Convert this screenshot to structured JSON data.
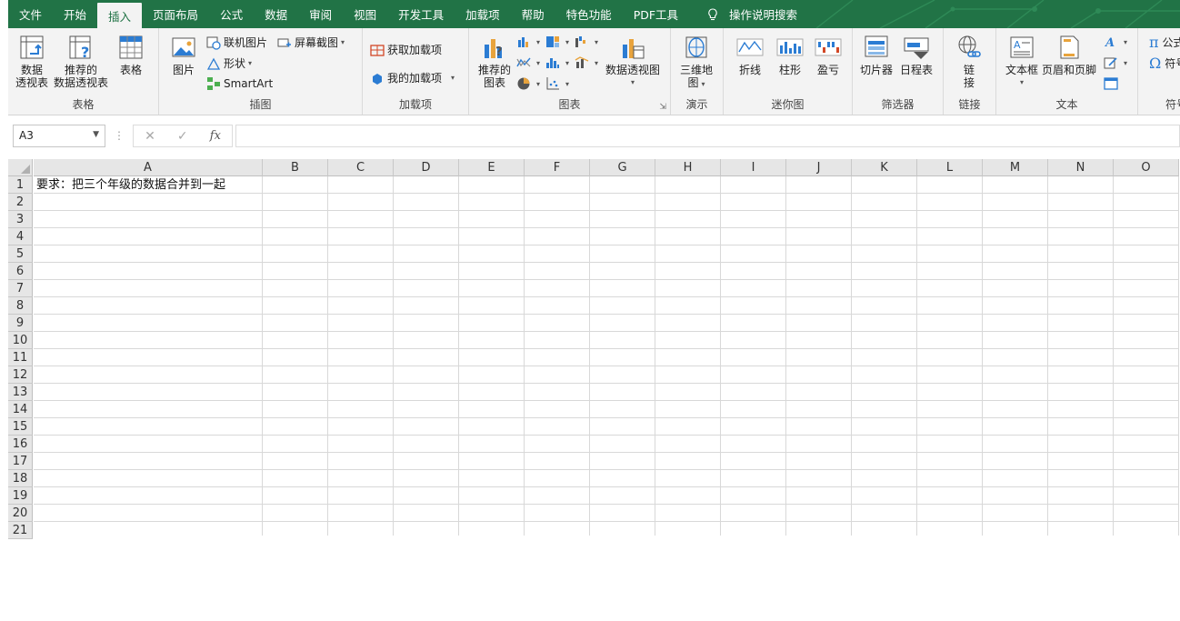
{
  "tabs": [
    {
      "label": "文件",
      "active": false
    },
    {
      "label": "开始",
      "active": false
    },
    {
      "label": "插入",
      "active": true
    },
    {
      "label": "页面布局",
      "active": false
    },
    {
      "label": "公式",
      "active": false
    },
    {
      "label": "数据",
      "active": false
    },
    {
      "label": "审阅",
      "active": false
    },
    {
      "label": "视图",
      "active": false
    },
    {
      "label": "开发工具",
      "active": false
    },
    {
      "label": "加载项",
      "active": false
    },
    {
      "label": "帮助",
      "active": false
    },
    {
      "label": "特色功能",
      "active": false
    },
    {
      "label": "PDF工具",
      "active": false
    }
  ],
  "tell_me": "操作说明搜索",
  "ribbon": {
    "tables": {
      "label": "表格",
      "pivot_line1": "数据",
      "pivot_line2": "透视表",
      "recpivot_line1": "推荐的",
      "recpivot_line2": "数据透视表",
      "table": "表格"
    },
    "illustrations": {
      "label": "插图",
      "picture": "图片",
      "online_picture": "联机图片",
      "shapes": "形状",
      "smartart": "SmartArt",
      "screenshot": "屏幕截图"
    },
    "addins": {
      "label": "加载项",
      "get": "获取加载项",
      "mine": "我的加载项"
    },
    "charts": {
      "label": "图表",
      "recommended_line1": "推荐的",
      "recommended_line2": "图表",
      "pivotchart": "数据透视图"
    },
    "tours": {
      "label": "演示",
      "map3d_line1": "三维地",
      "map3d_line2": "图"
    },
    "sparklines": {
      "label": "迷你图",
      "line": "折线",
      "column": "柱形",
      "winloss": "盈亏"
    },
    "filters": {
      "label": "筛选器",
      "slicer": "切片器",
      "timeline": "日程表"
    },
    "links": {
      "label": "链接",
      "link_line1": "链",
      "link_line2": "接"
    },
    "text": {
      "label": "文本",
      "textbox": "文本框",
      "headerfooter": "页眉和页脚"
    },
    "symbols": {
      "label": "符号",
      "equation": "公式",
      "symbol": "符号"
    }
  },
  "namebox": "A3",
  "formula": "",
  "columns": [
    "A",
    "B",
    "C",
    "D",
    "E",
    "F",
    "G",
    "H",
    "I",
    "J",
    "K",
    "L",
    "M",
    "N",
    "O"
  ],
  "rows": [
    "1",
    "2",
    "3",
    "4",
    "5",
    "6",
    "7",
    "8",
    "9",
    "10",
    "11",
    "12",
    "13",
    "14",
    "15",
    "16",
    "17",
    "18",
    "19",
    "20",
    "21"
  ],
  "cells": {
    "A1": "要求：把三个年级的数据合并到一起"
  },
  "colors": {
    "accent": "#217346",
    "ribbon_bg": "#f3f3f3",
    "header_bg": "#e6e6e6"
  }
}
